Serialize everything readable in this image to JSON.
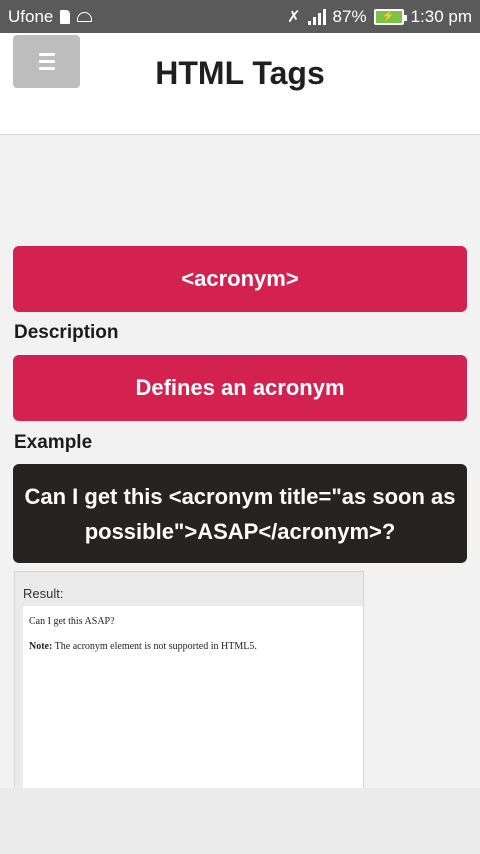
{
  "status": {
    "carrier": "Ufone",
    "battery_percent": "87%",
    "time": "1:30 pm"
  },
  "icons": {
    "menu": "hamburger-icon",
    "sd": "sd-card-icon",
    "android": "android-icon",
    "mute": "mute-icon",
    "signal": "signal-icon",
    "battery": "battery-icon"
  },
  "colors": {
    "accent": "#d42250",
    "example_bg": "#272320",
    "statusbar": "#5a5a5a"
  },
  "header": {
    "title": "HTML Tags"
  },
  "tag": {
    "name": "<acronym>"
  },
  "description": {
    "label": "Description",
    "text": "Defines an acronym"
  },
  "example": {
    "label": "Example",
    "code": "Can I get this <acronym title=\"as soon as possible\">ASAP</acronym>?"
  },
  "result": {
    "label": "Result:",
    "line1": "Can I get this ASAP?",
    "note_label": "Note:",
    "note_text": " The acronym element is not supported in HTML5."
  }
}
